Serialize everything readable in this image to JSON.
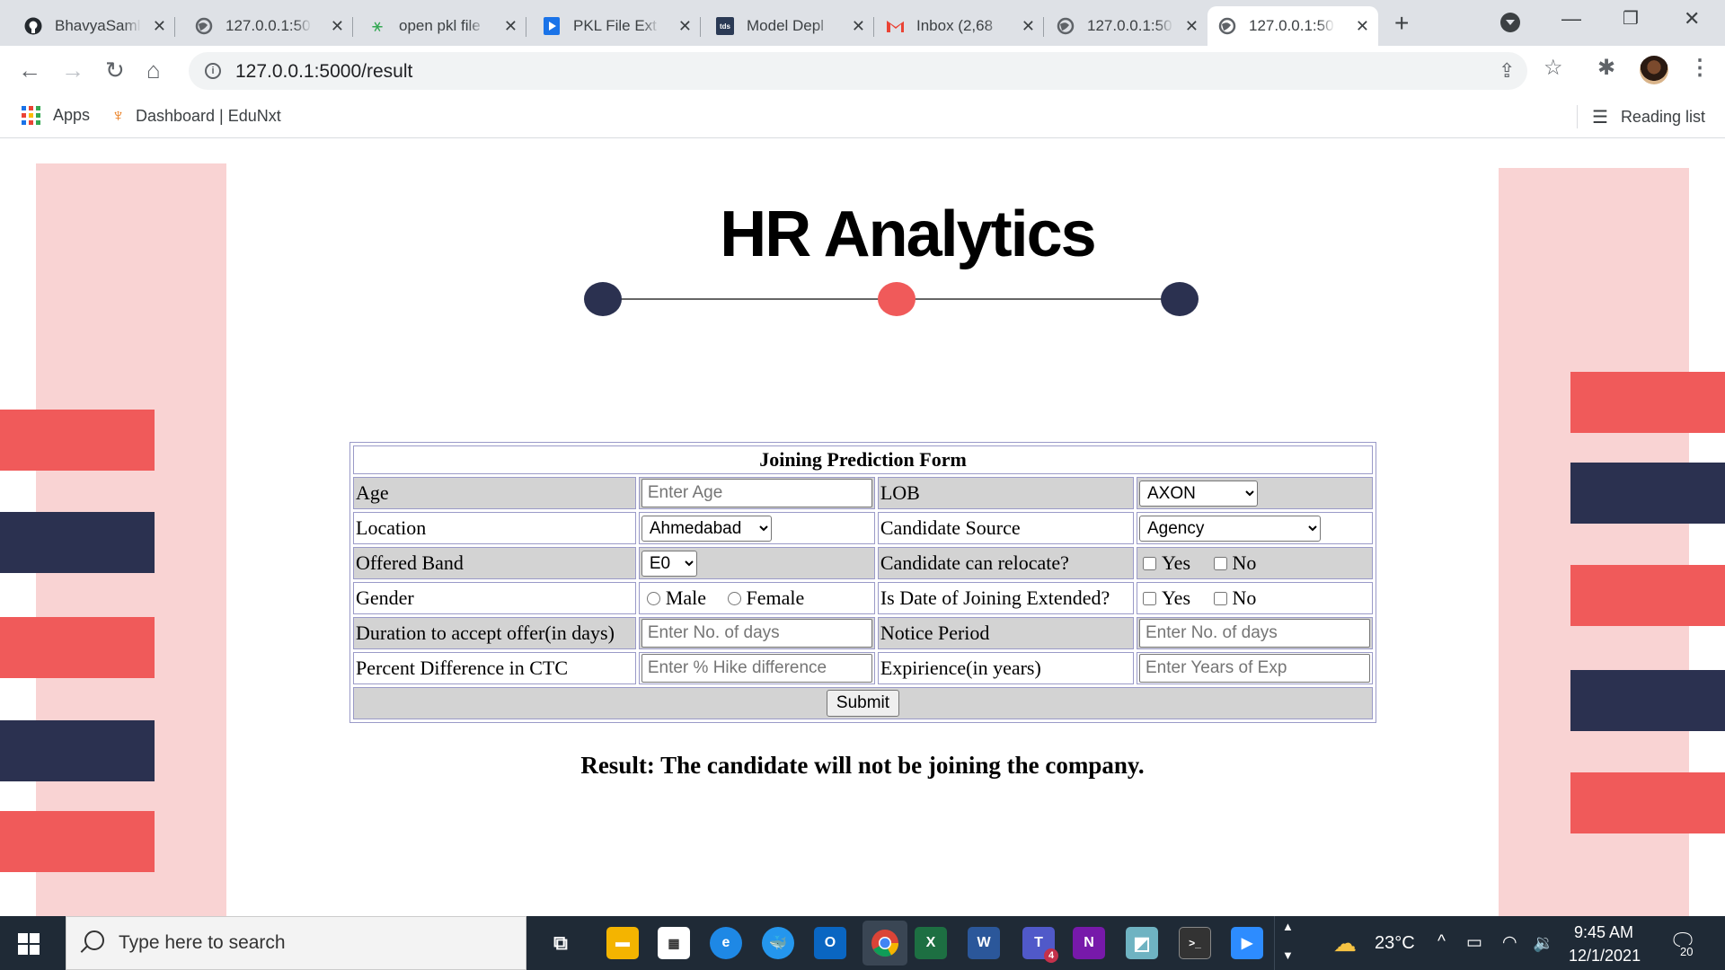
{
  "browser": {
    "tabs": [
      {
        "title": "BhavyaSaml",
        "icon": "github-icon"
      },
      {
        "title": "127.0.0.1:50",
        "icon": "globe-icon"
      },
      {
        "title": "open pkl file",
        "icon": "sparkle-icon"
      },
      {
        "title": "PKL File Ext",
        "icon": "play-file-icon"
      },
      {
        "title": "Model Depl",
        "icon": "tds-icon"
      },
      {
        "title": "Inbox (2,68",
        "icon": "gmail-icon"
      },
      {
        "title": "127.0.0.1:50",
        "icon": "globe-icon"
      },
      {
        "title": "127.0.0.1:50",
        "icon": "globe-icon"
      }
    ],
    "url": "127.0.0.1:5000/result",
    "bookmarks": {
      "apps": "Apps",
      "dashboard": "Dashboard | EduNxt",
      "reading_list": "Reading list"
    }
  },
  "page": {
    "title": "HR Analytics",
    "colors": {
      "navy": "#2b3150",
      "coral": "#f05a5a",
      "pink": "#f9d3d3"
    },
    "form": {
      "caption": "Joining Prediction Form",
      "age_label": "Age",
      "age_placeholder": "Enter Age",
      "lob_label": "LOB",
      "lob_value": "AXON",
      "location_label": "Location",
      "location_value": "Ahmedabad",
      "source_label": "Candidate Source",
      "source_value": "Agency",
      "band_label": "Offered Band",
      "band_value": "E0",
      "relocate_label": "Candidate can relocate?",
      "yes": "Yes",
      "no": "No",
      "gender_label": "Gender",
      "male": "Male",
      "female": "Female",
      "doj_label": "Is Date of Joining Extended?",
      "duration_label": "Duration to accept offer(in days)",
      "duration_placeholder": "Enter No. of days",
      "notice_label": "Notice Period",
      "notice_placeholder": "Enter No. of days",
      "ctc_label": "Percent Difference in CTC",
      "ctc_placeholder": "Enter % Hike difference",
      "exp_label": "Expirience(in years)",
      "exp_placeholder": "Enter Years of Exp",
      "submit": "Submit"
    },
    "result": "Result: The candidate will not be joining the company."
  },
  "taskbar": {
    "search_placeholder": "Type here to search",
    "temperature": "23°C",
    "time": "9:45 AM",
    "date": "12/1/2021",
    "notification_count": "20",
    "teams_badge": "4"
  }
}
